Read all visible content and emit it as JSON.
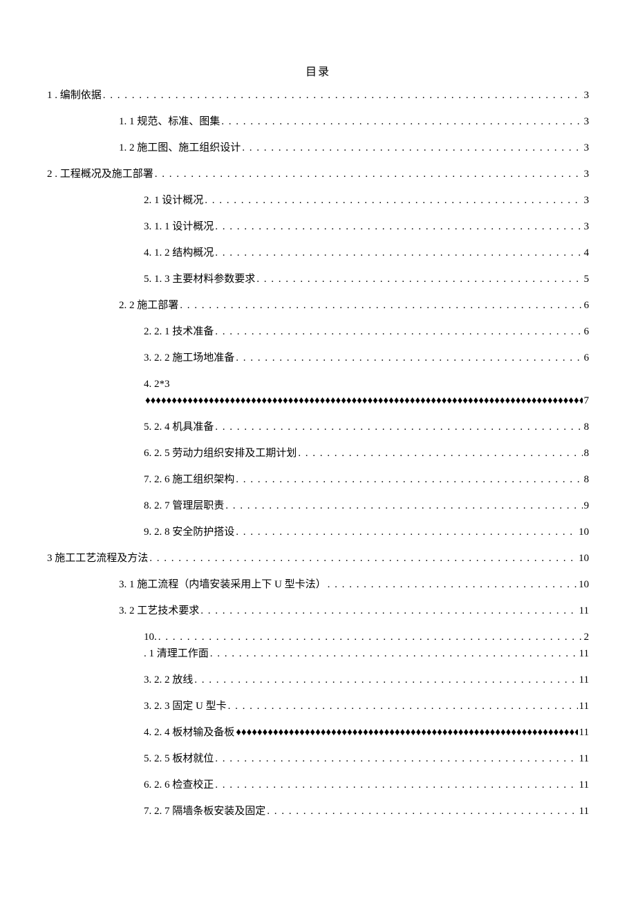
{
  "title": "目录",
  "entries": {
    "e1": {
      "label": "1 . 编制依据",
      "page": "3"
    },
    "e2": {
      "label": "1. 1  规范、标准、图集 ",
      "page": "3"
    },
    "e3": {
      "label": "1. 2  施工图、施工组织设计 ",
      "page": "3"
    },
    "e4": {
      "label": "2  . 工程概况及施工部署",
      "page": "3"
    },
    "e5": {
      "label": "2.  1 设计概况",
      "page": "3"
    },
    "e6": {
      "label": "3.  1. 1 设计概况",
      "page": "3"
    },
    "e7": {
      "label": "4.  1. 2 结构概况",
      "page": "4"
    },
    "e8": {
      "label": "5.  1. 3 主要材料参数要求",
      "page": "5"
    },
    "e9": {
      "label": "2.  2 施工部署 ",
      "page": "6"
    },
    "e10": {
      "label": "2.  2. 1 技术准备",
      "page": "6"
    },
    "e11": {
      "label": "3.  2. 2 施工场地准备",
      "page": "6"
    },
    "e12_top": "4.  2*3",
    "e12_page": "7",
    "e13": {
      "label": "5.  2. 4 机具准备",
      "page": "8"
    },
    "e14": {
      "label": "6.  2. 5 劳动力组织安排及工期计划",
      "page": "8"
    },
    "e15": {
      "label": "7.  2. 6 施工组织架构",
      "page": "8"
    },
    "e16": {
      "label": "8.  2. 7 管理层职责",
      "page": "9"
    },
    "e17": {
      "label": "9.  2. 8 安全防护搭设 ",
      "page": "10"
    },
    "e18": {
      "label": "3 施工工艺流程及方法 ",
      "page": "10"
    },
    "e19": {
      "label": "3. 1 施工流程（内墙安装采用上下 U 型卡法） ",
      "page": "10"
    },
    "e20": {
      "label": "3.  2 工艺技术要求",
      "page": "11"
    },
    "e21_line1_label": "10.  ",
    "e21_line1_page": "2",
    "e21_line2_label": ". 1 清理工作面",
    "e21_line2_page": "11",
    "e22": {
      "label": "3.  2. 2 放线 ",
      "page": "11"
    },
    "e23": {
      "label": "3.  2. 3 固定 U 型卡 ",
      "page": "11"
    },
    "e24": {
      "label": "4.  2. 4 板材输及备板",
      "page": "11"
    },
    "e25": {
      "label": "5.  2. 5 板材就位 ",
      "page": "11"
    },
    "e26": {
      "label": "6.  2. 6 检查校正 ",
      "page": "11"
    },
    "e27": {
      "label": "7.  2. 7 隔墙条板安装及固定 ",
      "page": "11"
    }
  }
}
